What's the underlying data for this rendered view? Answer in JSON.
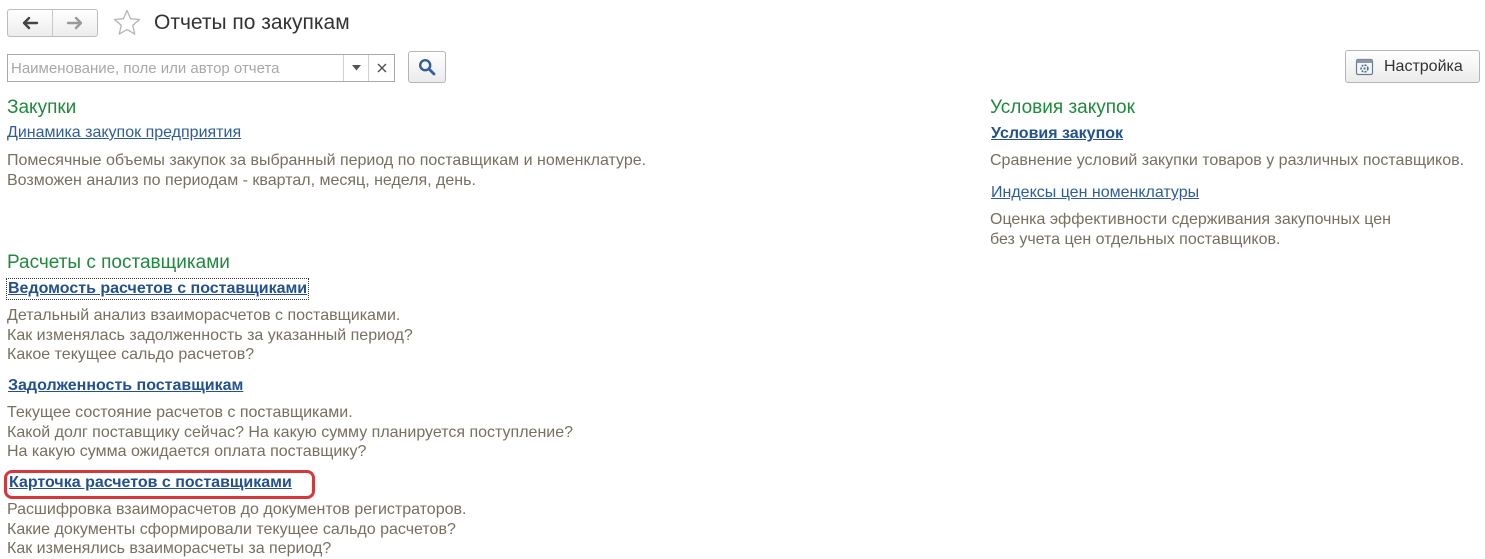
{
  "window": {
    "title": "Отчеты по закупкам"
  },
  "search": {
    "placeholder": "Наименование, поле или автор отчета",
    "value": ""
  },
  "toolbar": {
    "settings_label": "Настройка"
  },
  "sections": {
    "purchases": {
      "title": "Закупки",
      "reports": [
        {
          "label": "Динамика закупок предприятия",
          "description": [
            "Помесячные объемы закупок за выбранный период по поставщикам и номенклатуре.",
            "Возможен анализ по периодам - квартал, месяц, неделя, день."
          ]
        }
      ]
    },
    "settlements": {
      "title": "Расчеты с поставщиками",
      "reports": [
        {
          "label": "Ведомость расчетов с поставщиками",
          "description": [
            "Детальный анализ взаиморасчетов с поставщиками.",
            "Как изменялась задолженность за указанный период?",
            "Какое текущее сальдо расчетов?"
          ]
        },
        {
          "label": "Задолженность поставщикам",
          "description": [
            "Текущее состояние расчетов с поставщиками.",
            "Какой долг поставщику сейчас? На какую сумму планируется поступление?",
            "На какую сумма ожидается оплата поставщику?"
          ]
        },
        {
          "label": "Карточка расчетов с поставщиками",
          "description": [
            "Расшифровка взаиморасчетов до документов регистраторов.",
            "Какие документы сформировали текущее сальдо расчетов?",
            "Как изменялись взаиморасчеты за период?"
          ]
        }
      ]
    },
    "conditions": {
      "title": "Условия закупок",
      "reports": [
        {
          "label": "Условия закупок",
          "description": [
            "Сравнение условий закупки товаров у различных поставщиков."
          ]
        },
        {
          "label": "Индексы цен номенклатуры",
          "description": [
            "Оценка эффективности сдерживания закупочных цен",
            "без учета цен отдельных поставщиков."
          ]
        }
      ]
    }
  },
  "colors": {
    "section_title": "#1e8a3c",
    "link": "#2e5d9a",
    "description": "#776f5f",
    "highlight": "#d6373a"
  }
}
